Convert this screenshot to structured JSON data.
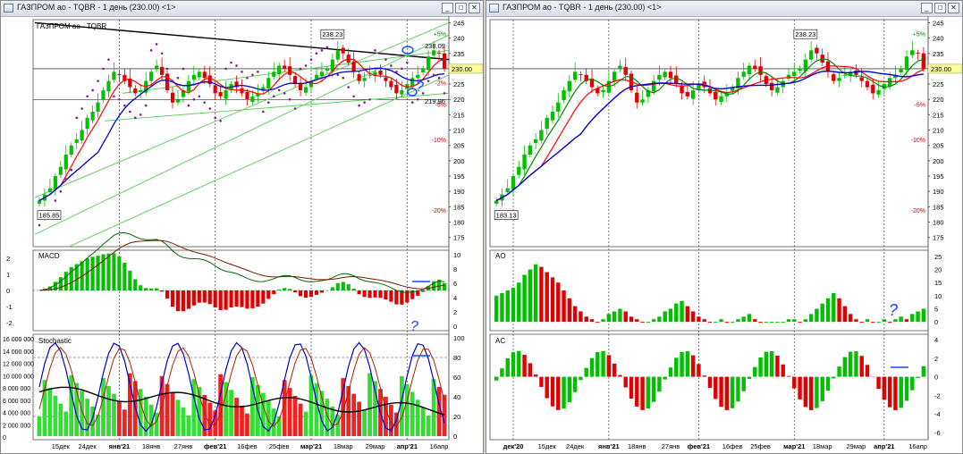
{
  "windows": [
    {
      "title": "ГАЗПРОМ ао - TQBR - 1 день (230.00) <1>",
      "chart_label": "ГАЗПРОМ ао - TQBR",
      "price_axis": [
        "245",
        "240",
        "235",
        "230",
        "225",
        "220",
        "215",
        "210",
        "205",
        "200",
        "195",
        "190",
        "185",
        "180",
        "175"
      ],
      "price_labels": {
        "last": "230.00",
        "high": "238.09",
        "low": "219.96"
      },
      "callouts": {
        "peak": "238.23",
        "trough": "185.85"
      },
      "pct_labels": [
        "+5%",
        "-2%",
        "-5%",
        "-10%",
        "-20%"
      ],
      "panes": {
        "macd": "MACD",
        "stoch": "Stochastic"
      },
      "macd_axis": [
        "2",
        "1",
        "0",
        "-1",
        "-2"
      ],
      "macd_right_axis": [
        "10",
        "8",
        "6",
        "4",
        "2",
        "0"
      ],
      "stoch_axis": [
        "16 000 000",
        "14 000 000",
        "12 000 000",
        "10 000 000",
        "8 000 000",
        "6 000 000",
        "4 000 000",
        "2 000 000",
        "0"
      ],
      "stoch_right_axis": [
        "100",
        "80",
        "60",
        "40",
        "20",
        "0"
      ],
      "dates": [
        "15дек",
        "24дек",
        "янв'21",
        "18янв",
        "27янв",
        "фев'21",
        "16фев",
        "25фев",
        "мар'21",
        "18мар",
        "29мар",
        "апр'21",
        "16апр"
      ],
      "annotations": [
        "?",
        "?"
      ]
    },
    {
      "title": "ГАЗПРОМ ао - TQBR - 1 день (230.00) <1>",
      "price_axis": [
        "245",
        "240",
        "235",
        "230",
        "225",
        "220",
        "215",
        "210",
        "205",
        "200",
        "195",
        "190",
        "185",
        "180",
        "175",
        "170"
      ],
      "price_labels": {
        "last": "230.00"
      },
      "callouts": {
        "peak": "238.23",
        "trough": "183.13"
      },
      "pct_labels": [
        "+5%",
        "-5%",
        "-10%",
        "-20%"
      ],
      "panes": {
        "ao": "AO",
        "ac": "AC"
      },
      "ao_axis": [
        "25",
        "20",
        "15",
        "10",
        "5",
        "0"
      ],
      "ac_axis": [
        "4",
        "2",
        "0",
        "-2",
        "-4",
        "-6"
      ],
      "dates": [
        "дек'20",
        "15дек",
        "24дек",
        "янв'21",
        "18янв",
        "27янв",
        "фев'21",
        "16фев",
        "25фев",
        "мар'21",
        "18мар",
        "29мар",
        "апр'21",
        "16апр"
      ],
      "annotations": [
        "?"
      ]
    }
  ],
  "chart_data": [
    {
      "type": "candlestick",
      "symbol": "ГАЗПРОМ ао - TQBR",
      "close": [
        187,
        189,
        191,
        195,
        198,
        202,
        205,
        207,
        210,
        214,
        216,
        219,
        223,
        226,
        229,
        228,
        226,
        224,
        222,
        223,
        226,
        229,
        231,
        228,
        223,
        219,
        220,
        223,
        226,
        228,
        229,
        227,
        225,
        222,
        221,
        223,
        225,
        224,
        222,
        220,
        221,
        222,
        224,
        227,
        229,
        231,
        230,
        228,
        225,
        223,
        224,
        226,
        228,
        229,
        230,
        233,
        236,
        235,
        232,
        229,
        226,
        227,
        228,
        229,
        228,
        226,
        224,
        222,
        223,
        225,
        227,
        228,
        230,
        234,
        236,
        235,
        230
      ],
      "ylim": [
        172,
        246
      ]
    }
  ],
  "colors": {
    "up": "#00c000",
    "down": "#e00000",
    "ma_red": "#ff0000",
    "ma_blue": "#0000d0",
    "ma_green": "#008800",
    "ma_dark": "#7a1a00",
    "channel": "#55cc55",
    "sar": "#8a1a8a",
    "ink": "#1048ff"
  }
}
